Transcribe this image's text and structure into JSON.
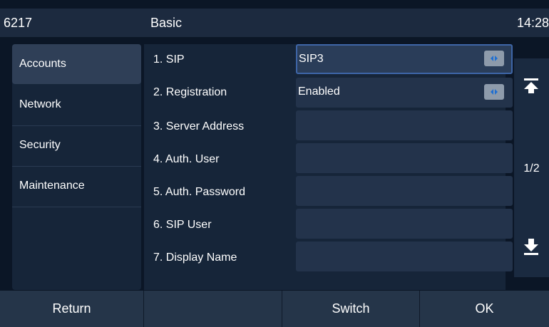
{
  "status_bar": {
    "extension": "6217",
    "title": "Basic",
    "time": "14:28"
  },
  "sidebar": {
    "items": [
      {
        "label": "Accounts",
        "active": true
      },
      {
        "label": "Network",
        "active": false
      },
      {
        "label": "Security",
        "active": false
      },
      {
        "label": "Maintenance",
        "active": false
      }
    ]
  },
  "settings": {
    "rows": [
      {
        "label": "1. SIP",
        "value": "SIP3",
        "selectable": true,
        "focused": true
      },
      {
        "label": "2. Registration",
        "value": "Enabled",
        "selectable": true,
        "focused": false
      },
      {
        "label": "3. Server Address",
        "value": ""
      },
      {
        "label": "4. Auth. User",
        "value": ""
      },
      {
        "label": "5. Auth. Password",
        "value": ""
      },
      {
        "label": "6. SIP User",
        "value": ""
      },
      {
        "label": "7. Display Name",
        "value": ""
      }
    ]
  },
  "scroll": {
    "page_indicator": "1/2",
    "up_icon": "page-top-icon",
    "down_icon": "page-bottom-icon"
  },
  "softkeys": {
    "return": "Return",
    "empty": "",
    "switch": "Switch",
    "ok": "OK"
  },
  "colors": {
    "accent_border": "#3e66a8",
    "arrow_blue": "#1f6fd1",
    "background": "#0b1626"
  }
}
